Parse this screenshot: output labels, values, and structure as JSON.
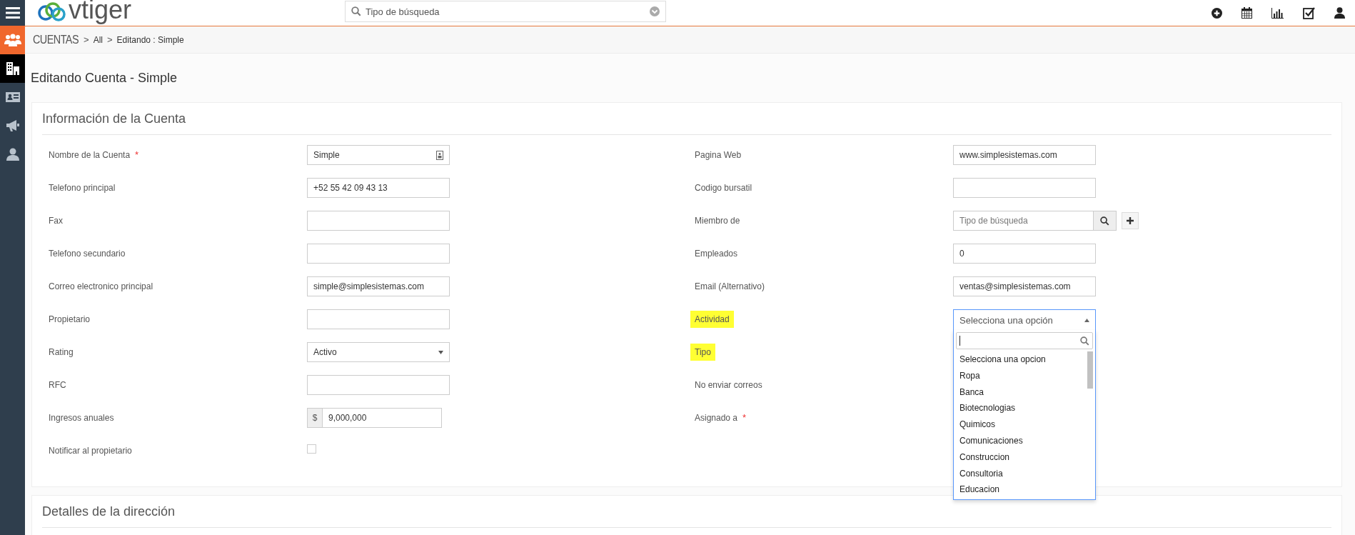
{
  "header": {
    "logo_text": "vtiger",
    "search": {
      "placeholder": "Tipo de búsqueda"
    }
  },
  "sidebar": {
    "items": [
      {
        "selected": true,
        "hovered": false
      },
      {
        "selected": false,
        "hovered": true
      },
      {
        "selected": false,
        "hovered": false
      },
      {
        "selected": false,
        "hovered": false
      },
      {
        "selected": false,
        "hovered": false
      }
    ]
  },
  "breadcrumb": [
    {
      "kind": "module",
      "label": "CUENTAS"
    },
    {
      "kind": "separator",
      "label": ">"
    },
    {
      "kind": "link",
      "label": "All"
    },
    {
      "kind": "separator",
      "label": ">"
    },
    {
      "kind": "current",
      "label": "Editando : Simple"
    }
  ],
  "page_title": "Editando Cuenta - Simple",
  "sections": [
    {
      "title": "Información de la Cuenta",
      "left_fields": [
        {
          "label": "Nombre de la Cuenta",
          "required_mark": "*",
          "highlighted": false,
          "kind": "text-icon",
          "value": "Simple"
        },
        {
          "label": "Telefono principal",
          "highlighted": false,
          "kind": "text",
          "value": "+52 55 42 09 43 13"
        },
        {
          "label": "Fax",
          "highlighted": false,
          "kind": "text"
        },
        {
          "label": "Telefono secundario",
          "highlighted": false,
          "kind": "text"
        },
        {
          "label": "Correo electronico principal",
          "highlighted": false,
          "kind": "text",
          "value": "simple@simplesistemas.com"
        },
        {
          "label": "Propietario",
          "highlighted": false,
          "kind": "text"
        },
        {
          "label": "Rating",
          "highlighted": false,
          "kind": "select",
          "value": "Activo"
        },
        {
          "label": "RFC",
          "highlighted": false,
          "kind": "text"
        },
        {
          "label": "Ingresos anuales",
          "highlighted": false,
          "kind": "currency",
          "prefix": "$",
          "value": "9,000,000"
        },
        {
          "label": "Notificar al propietario",
          "highlighted": false,
          "kind": "checkbox",
          "checked": false
        }
      ],
      "right_fields": [
        {
          "label": "Pagina Web",
          "highlighted": false,
          "kind": "text",
          "value": "www.simplesistemas.com"
        },
        {
          "label": "Codigo bursatil",
          "highlighted": false,
          "kind": "text"
        },
        {
          "label": "Miembro de",
          "highlighted": false,
          "kind": "lookup",
          "placeholder": "Tipo de búsqueda"
        },
        {
          "label": "Empleados",
          "highlighted": false,
          "kind": "text",
          "value": "0"
        },
        {
          "label": "Email (Alternativo)",
          "highlighted": false,
          "kind": "text",
          "value": "ventas@simplesistemas.com"
        },
        {
          "label": "Actividad",
          "highlighted": true,
          "kind": "open-select",
          "value": "Selecciona una opción",
          "options": [
            {
              "label": "Selecciona una opcion",
              "selected": false
            },
            {
              "label": "Ropa",
              "selected": false
            },
            {
              "label": "Banca",
              "selected": false
            },
            {
              "label": "Biotecnologias",
              "selected": false
            },
            {
              "label": "Quimicos",
              "selected": false
            },
            {
              "label": "Comunicaciones",
              "selected": false
            },
            {
              "label": "Construccion",
              "selected": false
            },
            {
              "label": "Consultoria",
              "selected": false
            },
            {
              "label": "Educacion",
              "selected": false
            }
          ]
        },
        {
          "label": "Tipo",
          "highlighted": true,
          "kind": "covered"
        },
        {
          "label": "No enviar correos",
          "highlighted": false,
          "kind": "covered"
        },
        {
          "label": "Asignado a",
          "required_mark": "*",
          "highlighted": false,
          "kind": "covered"
        }
      ]
    },
    {
      "title": "Detalles de la dirección"
    }
  ]
}
